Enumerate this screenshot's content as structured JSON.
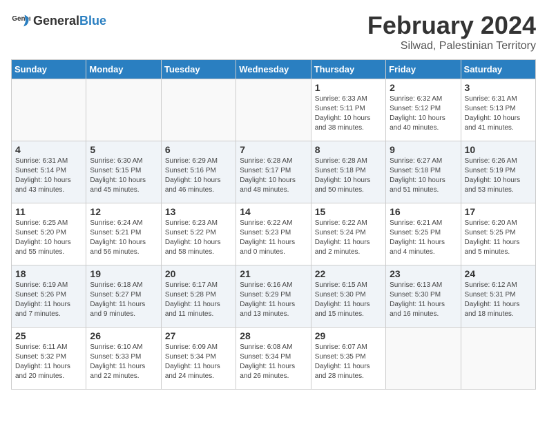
{
  "logo": {
    "text_general": "General",
    "text_blue": "Blue"
  },
  "calendar": {
    "title": "February 2024",
    "subtitle": "Silwad, Palestinian Territory"
  },
  "headers": [
    "Sunday",
    "Monday",
    "Tuesday",
    "Wednesday",
    "Thursday",
    "Friday",
    "Saturday"
  ],
  "weeks": [
    [
      {
        "day": "",
        "info": ""
      },
      {
        "day": "",
        "info": ""
      },
      {
        "day": "",
        "info": ""
      },
      {
        "day": "",
        "info": ""
      },
      {
        "day": "1",
        "info": "Sunrise: 6:33 AM\nSunset: 5:11 PM\nDaylight: 10 hours\nand 38 minutes."
      },
      {
        "day": "2",
        "info": "Sunrise: 6:32 AM\nSunset: 5:12 PM\nDaylight: 10 hours\nand 40 minutes."
      },
      {
        "day": "3",
        "info": "Sunrise: 6:31 AM\nSunset: 5:13 PM\nDaylight: 10 hours\nand 41 minutes."
      }
    ],
    [
      {
        "day": "4",
        "info": "Sunrise: 6:31 AM\nSunset: 5:14 PM\nDaylight: 10 hours\nand 43 minutes."
      },
      {
        "day": "5",
        "info": "Sunrise: 6:30 AM\nSunset: 5:15 PM\nDaylight: 10 hours\nand 45 minutes."
      },
      {
        "day": "6",
        "info": "Sunrise: 6:29 AM\nSunset: 5:16 PM\nDaylight: 10 hours\nand 46 minutes."
      },
      {
        "day": "7",
        "info": "Sunrise: 6:28 AM\nSunset: 5:17 PM\nDaylight: 10 hours\nand 48 minutes."
      },
      {
        "day": "8",
        "info": "Sunrise: 6:28 AM\nSunset: 5:18 PM\nDaylight: 10 hours\nand 50 minutes."
      },
      {
        "day": "9",
        "info": "Sunrise: 6:27 AM\nSunset: 5:18 PM\nDaylight: 10 hours\nand 51 minutes."
      },
      {
        "day": "10",
        "info": "Sunrise: 6:26 AM\nSunset: 5:19 PM\nDaylight: 10 hours\nand 53 minutes."
      }
    ],
    [
      {
        "day": "11",
        "info": "Sunrise: 6:25 AM\nSunset: 5:20 PM\nDaylight: 10 hours\nand 55 minutes."
      },
      {
        "day": "12",
        "info": "Sunrise: 6:24 AM\nSunset: 5:21 PM\nDaylight: 10 hours\nand 56 minutes."
      },
      {
        "day": "13",
        "info": "Sunrise: 6:23 AM\nSunset: 5:22 PM\nDaylight: 10 hours\nand 58 minutes."
      },
      {
        "day": "14",
        "info": "Sunrise: 6:22 AM\nSunset: 5:23 PM\nDaylight: 11 hours\nand 0 minutes."
      },
      {
        "day": "15",
        "info": "Sunrise: 6:22 AM\nSunset: 5:24 PM\nDaylight: 11 hours\nand 2 minutes."
      },
      {
        "day": "16",
        "info": "Sunrise: 6:21 AM\nSunset: 5:25 PM\nDaylight: 11 hours\nand 4 minutes."
      },
      {
        "day": "17",
        "info": "Sunrise: 6:20 AM\nSunset: 5:25 PM\nDaylight: 11 hours\nand 5 minutes."
      }
    ],
    [
      {
        "day": "18",
        "info": "Sunrise: 6:19 AM\nSunset: 5:26 PM\nDaylight: 11 hours\nand 7 minutes."
      },
      {
        "day": "19",
        "info": "Sunrise: 6:18 AM\nSunset: 5:27 PM\nDaylight: 11 hours\nand 9 minutes."
      },
      {
        "day": "20",
        "info": "Sunrise: 6:17 AM\nSunset: 5:28 PM\nDaylight: 11 hours\nand 11 minutes."
      },
      {
        "day": "21",
        "info": "Sunrise: 6:16 AM\nSunset: 5:29 PM\nDaylight: 11 hours\nand 13 minutes."
      },
      {
        "day": "22",
        "info": "Sunrise: 6:15 AM\nSunset: 5:30 PM\nDaylight: 11 hours\nand 15 minutes."
      },
      {
        "day": "23",
        "info": "Sunrise: 6:13 AM\nSunset: 5:30 PM\nDaylight: 11 hours\nand 16 minutes."
      },
      {
        "day": "24",
        "info": "Sunrise: 6:12 AM\nSunset: 5:31 PM\nDaylight: 11 hours\nand 18 minutes."
      }
    ],
    [
      {
        "day": "25",
        "info": "Sunrise: 6:11 AM\nSunset: 5:32 PM\nDaylight: 11 hours\nand 20 minutes."
      },
      {
        "day": "26",
        "info": "Sunrise: 6:10 AM\nSunset: 5:33 PM\nDaylight: 11 hours\nand 22 minutes."
      },
      {
        "day": "27",
        "info": "Sunrise: 6:09 AM\nSunset: 5:34 PM\nDaylight: 11 hours\nand 24 minutes."
      },
      {
        "day": "28",
        "info": "Sunrise: 6:08 AM\nSunset: 5:34 PM\nDaylight: 11 hours\nand 26 minutes."
      },
      {
        "day": "29",
        "info": "Sunrise: 6:07 AM\nSunset: 5:35 PM\nDaylight: 11 hours\nand 28 minutes."
      },
      {
        "day": "",
        "info": ""
      },
      {
        "day": "",
        "info": ""
      }
    ]
  ]
}
